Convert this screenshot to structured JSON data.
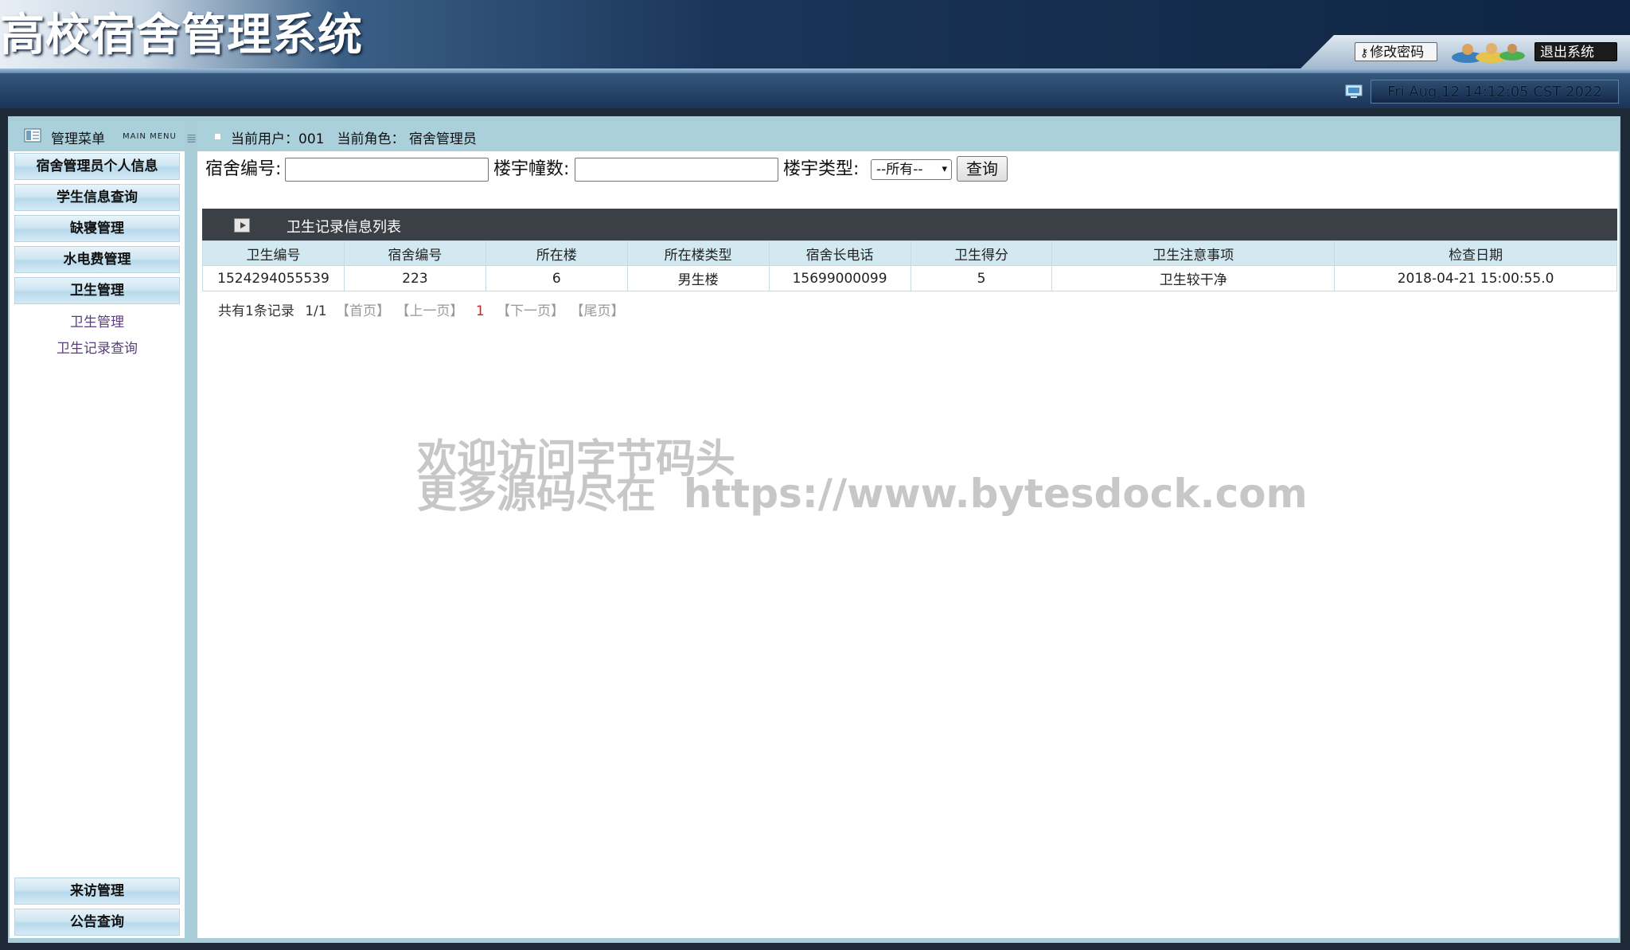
{
  "header": {
    "title": "高校宿舍管理系统",
    "change_password": "修改密码",
    "logout": "退出系统",
    "datetime": "Fri Aug 12 14:12:05 CST 2022"
  },
  "menu": {
    "title": "管理菜单",
    "subtitle": "MAIN MENU",
    "items": [
      {
        "label": "宿舍管理员个人信息"
      },
      {
        "label": "学生信息查询"
      },
      {
        "label": "缺寝管理"
      },
      {
        "label": "水电费管理"
      },
      {
        "label": "卫生管理"
      }
    ],
    "subitems": [
      {
        "label": "卫生管理"
      },
      {
        "label": "卫生记录查询"
      }
    ],
    "bottom_items": [
      {
        "label": "来访管理"
      },
      {
        "label": "公告查询"
      }
    ]
  },
  "userbar": {
    "current_user": "当前用户：001",
    "current_role": "当前角色： 宿舍管理员"
  },
  "search": {
    "dorm_no_label": "宿舍编号:",
    "dorm_no_value": "",
    "building_label": "楼宇幢数:",
    "building_value": "",
    "type_label": "楼宇类型:",
    "type_selected": "--所有--",
    "query_button": "查询"
  },
  "list": {
    "title": "卫生记录信息列表",
    "columns": [
      "卫生编号",
      "宿舍编号",
      "所在楼",
      "所在楼类型",
      "宿舍长电话",
      "卫生得分",
      "卫生注意事项",
      "检查日期"
    ],
    "rows": [
      [
        "1524294055539",
        "223",
        "6",
        "男生楼",
        "15699000099",
        "5",
        "卫生较干净",
        "2018-04-21 15:00:55.0"
      ]
    ]
  },
  "pager": {
    "summary": "共有1条记录",
    "pages": "1/1",
    "first": "【首页】",
    "prev": "【上一页】",
    "current": "1",
    "next": "【下一页】",
    "last": "【尾页】"
  },
  "watermark": {
    "line1": "欢迎访问字节码头",
    "line2": "更多源码尽在  https://www.bytesdock.com"
  }
}
